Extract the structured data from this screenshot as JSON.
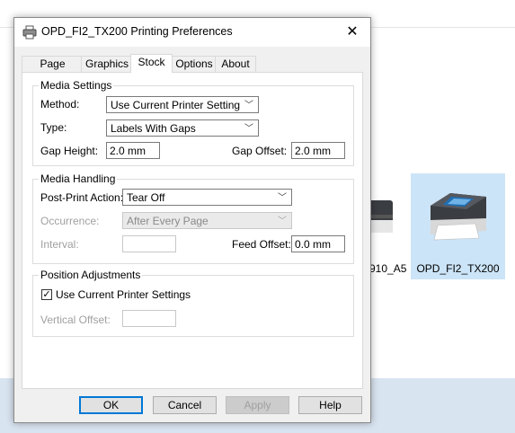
{
  "dialog": {
    "title": "OPD_FI2_TX200 Printing Preferences",
    "close_glyph": "✕"
  },
  "tabs": [
    {
      "label": "Page Setup"
    },
    {
      "label": "Graphics"
    },
    {
      "label": "Stock"
    },
    {
      "label": "Options"
    },
    {
      "label": "About"
    }
  ],
  "active_tab": "Stock",
  "media_settings": {
    "title": "Media Settings",
    "method_label": "Method:",
    "method_value": "Use Current Printer Setting",
    "type_label": "Type:",
    "type_value": "Labels With Gaps",
    "gap_height_label": "Gap Height:",
    "gap_height_value": "2.0 mm",
    "gap_offset_label": "Gap Offset:",
    "gap_offset_value": "2.0 mm"
  },
  "media_handling": {
    "title": "Media Handling",
    "post_print_label": "Post-Print Action:",
    "post_print_value": "Tear Off",
    "occurrence_label": "Occurrence:",
    "occurrence_value": "After Every Page",
    "interval_label": "Interval:",
    "interval_value": "",
    "feed_offset_label": "Feed Offset:",
    "feed_offset_value": "0.0 mm"
  },
  "position_adjustments": {
    "title": "Position Adjustments",
    "use_current_label": "Use Current Printer Settings",
    "use_current_checked": true,
    "vertical_offset_label": "Vertical Offset:",
    "vertical_offset_value": ""
  },
  "buttons": {
    "ok": "OK",
    "cancel": "Cancel",
    "apply": "Apply",
    "help": "Help"
  },
  "background": {
    "printer_name": "OPD_FI2_TX200",
    "partial_printer_name": "910_A5"
  },
  "colors": {
    "accent": "#0078d7",
    "selected_tile": "#cce4f7"
  }
}
